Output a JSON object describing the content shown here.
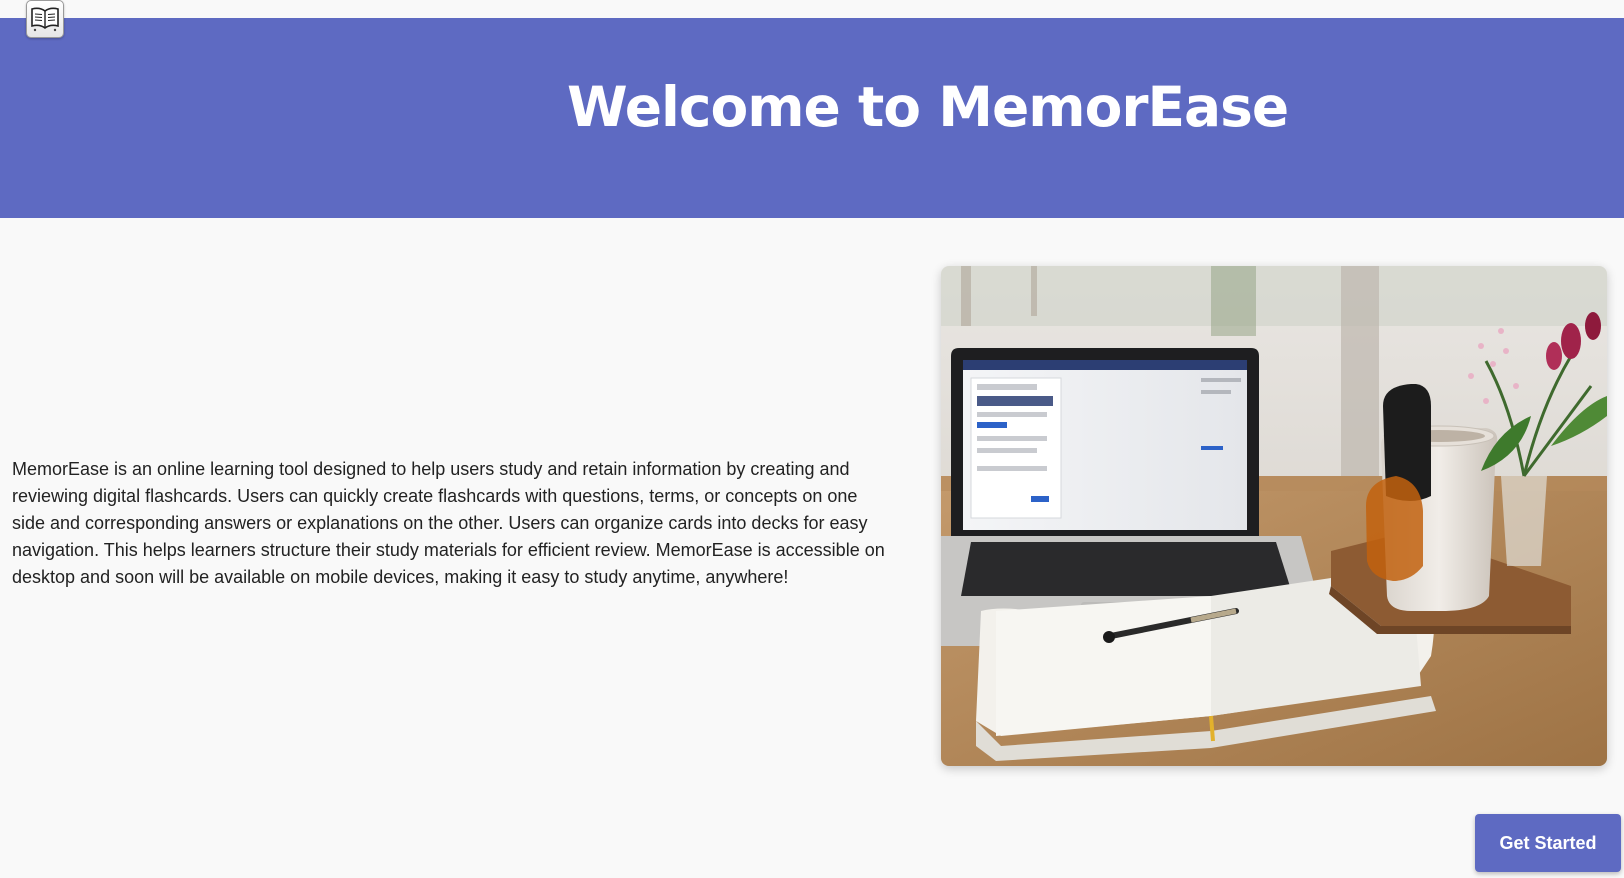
{
  "app": {
    "logo_icon": "open-book-icon"
  },
  "header": {
    "title": "Welcome to MemorEase",
    "background_color": "#5e6ac2"
  },
  "main": {
    "description": "MemorEase is an online learning tool designed to help users study and retain information by creating and reviewing digital flashcards. Users can quickly create flashcards with questions, terms, or concepts on one side and corresponding answers or explanations on the other. Users can organize cards into decks for easy navigation. This helps learners structure their study materials for efficient review. MemorEase is accessible on desktop and soon will be available on mobile devices, making it easy to study anytime, anywhere!",
    "image_subject": "laptop-notebook-coffee-photo"
  },
  "cta": {
    "label": "Get Started",
    "color": "#5e6ac2"
  }
}
